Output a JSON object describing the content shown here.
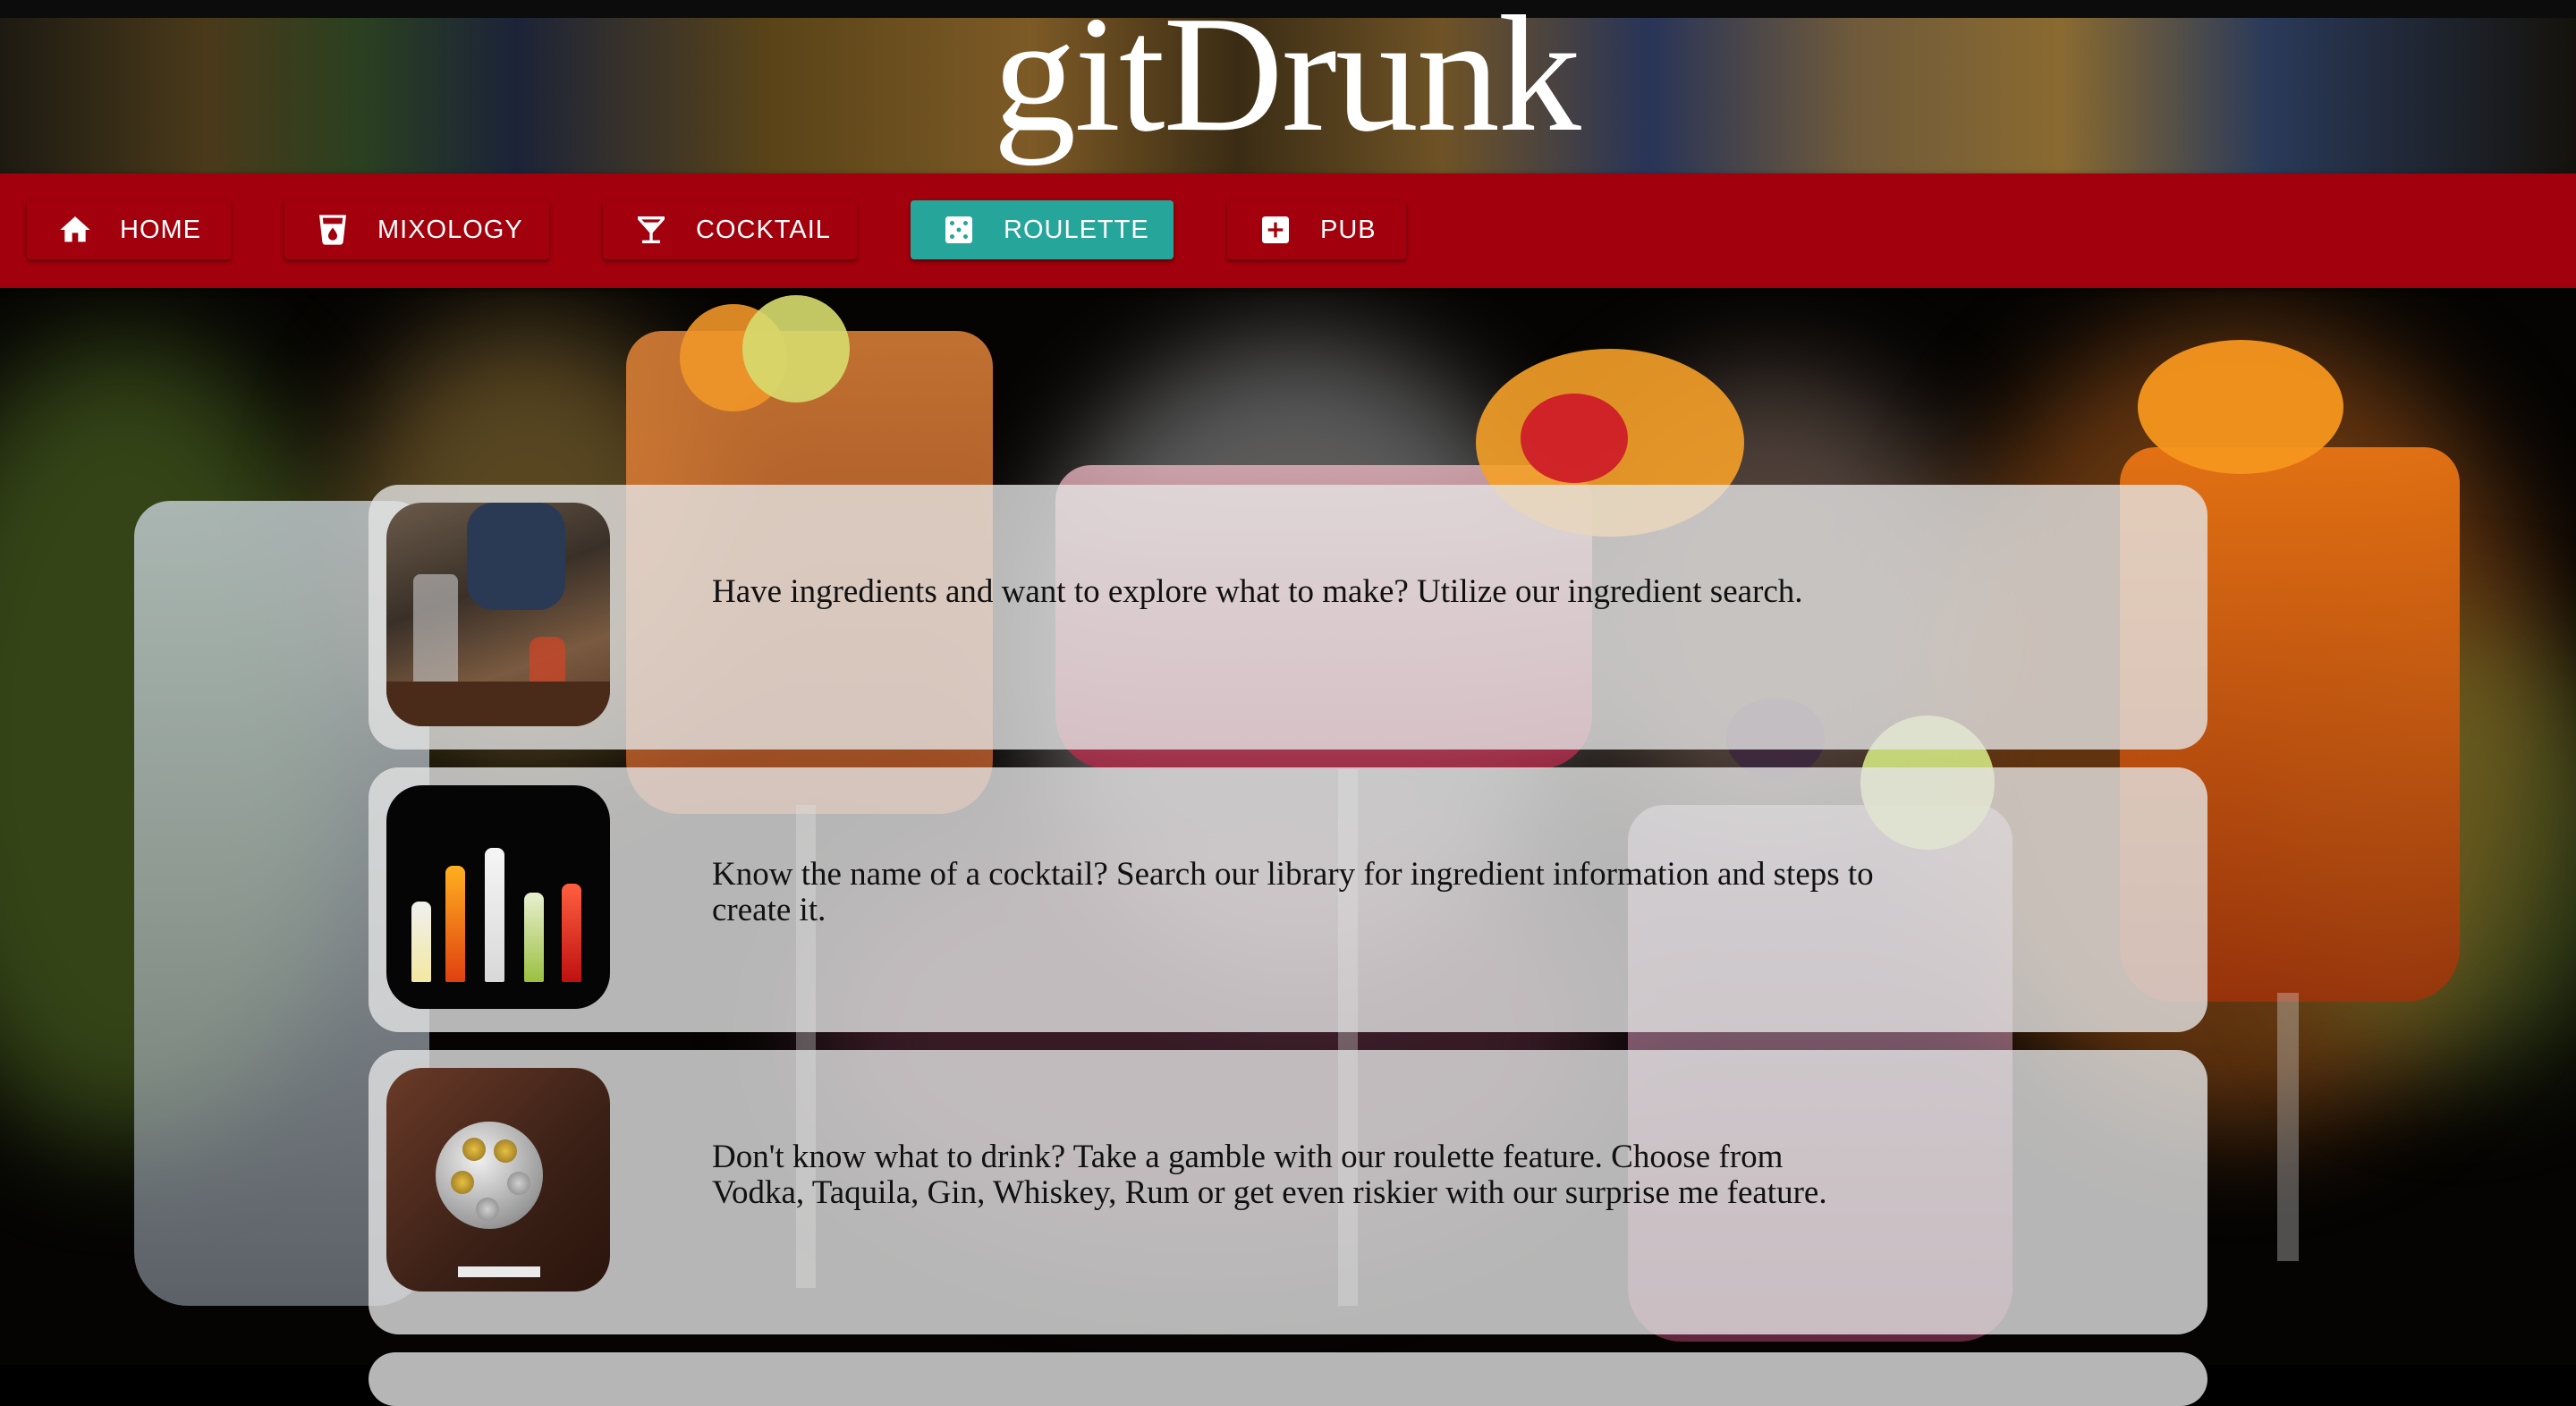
{
  "site": {
    "title": "gitDrunk"
  },
  "nav": {
    "items": [
      {
        "label": "HOME",
        "icon": "home-icon",
        "active": false
      },
      {
        "label": "MIXOLOGY",
        "icon": "cup-icon",
        "active": false
      },
      {
        "label": "COCKTAIL",
        "icon": "martini-icon",
        "active": false
      },
      {
        "label": "ROULETTE",
        "icon": "dice-icon",
        "active": true
      },
      {
        "label": "PUB",
        "icon": "plus-box-icon",
        "active": false
      }
    ]
  },
  "cards": [
    {
      "image": "bartender-image",
      "text": "Have ingredients and want to explore what to make? Utilize our ingredient search."
    },
    {
      "image": "cocktail-glasses-image",
      "text": "Know the name of a cocktail? Search our library for ingredient information and steps to create it."
    },
    {
      "image": "shot-roulette-image",
      "text": "Don't know what to drink? Take a gamble with our roulette feature. Choose from Vodka, Taquila, Gin, Whiskey, Rum or get even riskier with our surprise me feature."
    }
  ],
  "colors": {
    "navbar": "#a1000c",
    "active_button": "#26a69a",
    "card": "#e4e4e4"
  }
}
